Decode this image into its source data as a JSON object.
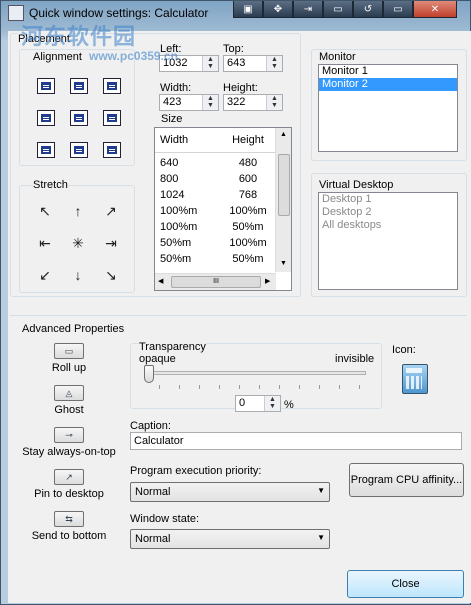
{
  "window": {
    "title": "Quick window settings: Calculator",
    "title_buttons": [
      "▣",
      "✥",
      "⇥",
      "▭",
      "↺",
      "▭",
      "✕"
    ]
  },
  "watermark": {
    "line1": "河东软件园",
    "line2": "www.pc0359.cn"
  },
  "placement": {
    "group_label": "Placement",
    "alignment_label": "Alignment",
    "left_label": "Left:",
    "left_value": "1032",
    "top_label": "Top:",
    "top_value": "643",
    "width_label": "Width:",
    "width_value": "423",
    "height_label": "Height:",
    "height_value": "322",
    "size_label": "Size",
    "size_table": {
      "headers": [
        "Width",
        "Height"
      ],
      "rows": [
        [
          "640",
          "480"
        ],
        [
          "800",
          "600"
        ],
        [
          "1024",
          "768"
        ],
        [
          "100%m",
          "100%m"
        ],
        [
          "100%m",
          "50%m"
        ],
        [
          "50%m",
          "100%m"
        ],
        [
          "50%m",
          "50%m"
        ]
      ],
      "hscroll_thumb": "III"
    },
    "stretch_label": "Stretch",
    "stretch_arrows": [
      "↖",
      "↑",
      "↗",
      "⇤",
      "✳",
      "⇥",
      "↙",
      "↓",
      "↘"
    ]
  },
  "monitor": {
    "label": "Monitor",
    "items": [
      "Monitor 1",
      "Monitor 2"
    ],
    "selected_index": 1
  },
  "virtual_desktop": {
    "label": "Virtual Desktop",
    "items": [
      "Desktop 1",
      "Desktop 2",
      "All desktops"
    ]
  },
  "advanced": {
    "label": "Advanced Properties",
    "buttons": [
      {
        "label": "Roll up",
        "icon": "rollup-icon",
        "glyph": "▭"
      },
      {
        "label": "Ghost",
        "icon": "ghost-icon",
        "glyph": "◬"
      },
      {
        "label": "Stay always-on-top",
        "icon": "pin-icon",
        "glyph": "⊸"
      },
      {
        "label": "Pin to desktop",
        "icon": "pushpin-icon",
        "glyph": "↗"
      },
      {
        "label": "Send to bottom",
        "icon": "send-bottom-icon",
        "glyph": "⇆"
      }
    ],
    "transparency_label": "Transparency",
    "opaque_label": "opaque",
    "invisible_label": "invisible",
    "transparency_value": "0",
    "percent": "%",
    "transparency_level": 0,
    "icon_label": "Icon:",
    "caption_label": "Caption:",
    "caption_value": "Calculator",
    "priority_label": "Program execution priority:",
    "priority_value": "Normal",
    "cpu_affinity_label": "Program CPU affinity...",
    "window_state_label": "Window state:",
    "window_state_value": "Normal"
  },
  "close_label": "Close"
}
